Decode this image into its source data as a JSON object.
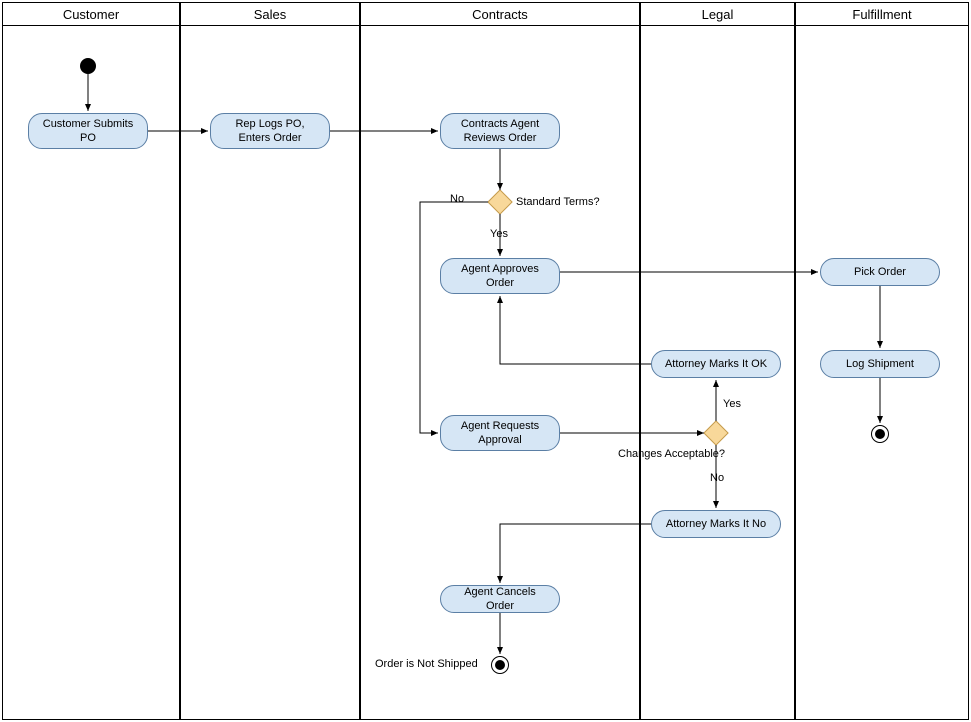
{
  "swimlanes": {
    "customer": "Customer",
    "sales": "Sales",
    "contracts": "Contracts",
    "legal": "Legal",
    "fulfillment": "Fulfillment"
  },
  "activities": {
    "customer_submits": "Customer Submits PO",
    "rep_logs": "Rep Logs PO, Enters Order",
    "reviews_order": "Contracts Agent Reviews Order",
    "approves_order": "Agent Approves Order",
    "requests_approval": "Agent Requests Approval",
    "cancels_order": "Agent Cancels Order",
    "marks_ok": "Attorney Marks It OK",
    "marks_no": "Attorney Marks It No",
    "pick_order": "Pick Order",
    "log_shipment": "Log Shipment"
  },
  "decisions": {
    "standard_terms": "Standard Terms?",
    "changes_acceptable": "Changes Acceptable?"
  },
  "labels": {
    "yes1": "Yes",
    "no1": "No",
    "yes2": "Yes",
    "no2": "No",
    "not_shipped": "Order is Not Shipped"
  }
}
